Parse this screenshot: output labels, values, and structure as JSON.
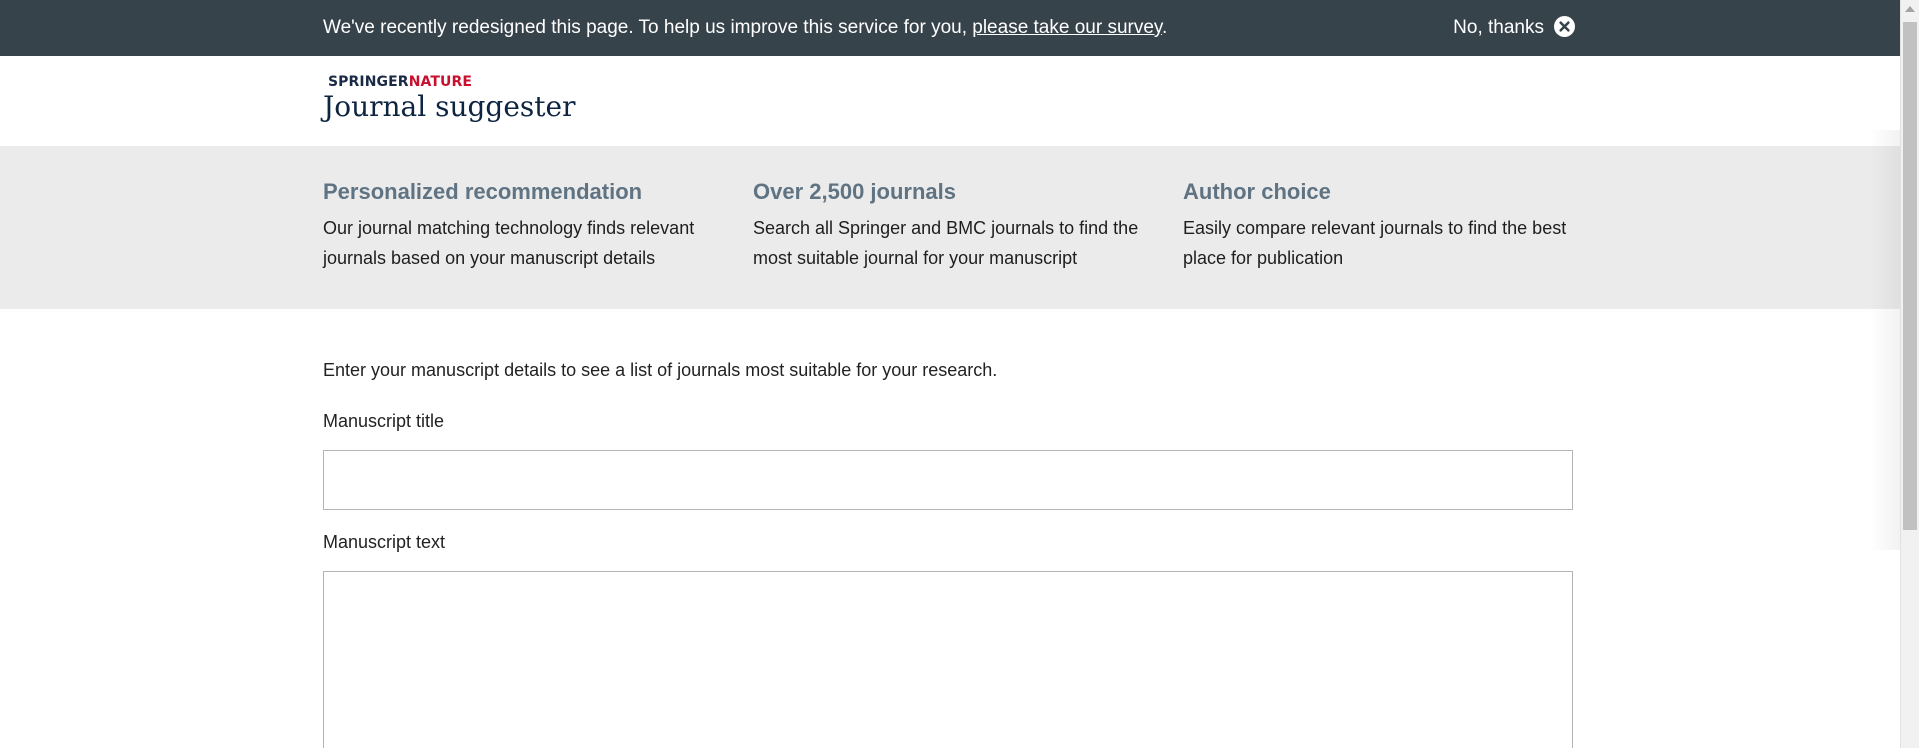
{
  "survey_banner": {
    "message": "We've recently redesigned this page. To help us improve this service for you, ",
    "link_text": "please take our survey",
    "message_end": ".",
    "dismiss_label": "No, thanks",
    "dismiss_icon": "close-circle-icon",
    "background_color": "#37434b"
  },
  "header": {
    "brand_springer": "SPRINGER",
    "brand_nature": "NATURE",
    "app_title": "Journal suggester"
  },
  "features": [
    {
      "title": "Personalized recommendation",
      "description": "Our journal matching technology finds relevant journals based on your manuscript details"
    },
    {
      "title": "Over 2,500 journals",
      "description": "Search all Springer and BMC journals to find the most suitable journal for your manuscript"
    },
    {
      "title": "Author choice",
      "description": "Easily compare relevant journals to find the best place for publication"
    }
  ],
  "form": {
    "intro": "Enter your manuscript details to see a list of journals most suitable for your research.",
    "title_label": "Manuscript title",
    "title_value": "",
    "text_label": "Manuscript text",
    "text_value": ""
  },
  "colors": {
    "brand_red": "#c8102e",
    "brand_navy": "#0e2541",
    "feature_title": "#5f7383",
    "features_background": "#ebebeb"
  }
}
